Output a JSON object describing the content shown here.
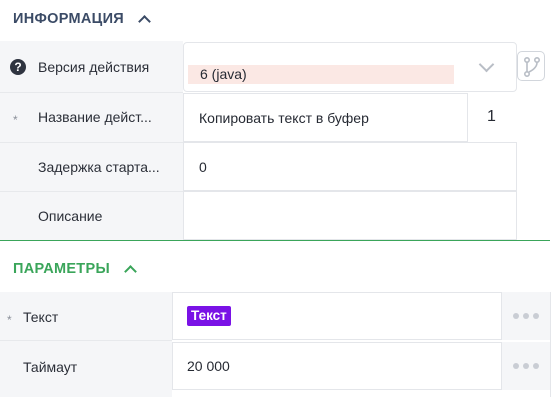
{
  "info_section": {
    "title": "ИНФОРМАЦИЯ",
    "rows": {
      "version": {
        "label": "Версия действия",
        "value": "6 (java)"
      },
      "name": {
        "label": "Название дейст...",
        "value": "Копировать текст в буфер",
        "index": "1"
      },
      "delay": {
        "label": "Задержка старта...",
        "value": "0"
      },
      "description": {
        "label": "Описание",
        "value": ""
      }
    }
  },
  "params_section": {
    "title": "ПАРАМЕТРЫ",
    "rows": {
      "text": {
        "label": "Текст",
        "chip": "Текст"
      },
      "timeout": {
        "label": "Таймаут",
        "value": "20 000"
      }
    }
  },
  "required_marker": "*",
  "icons": {
    "help": "help-icon",
    "collapse": "chevron-up-icon",
    "dropdown": "chevron-down-icon",
    "branch": "branch-icon",
    "more": "more-horizontal-icon"
  },
  "colors": {
    "info_title": "#3b4b66",
    "params_title": "#3aa55a",
    "variable_chip": "#7a12e6",
    "version_highlight": "#fbe8e4"
  }
}
